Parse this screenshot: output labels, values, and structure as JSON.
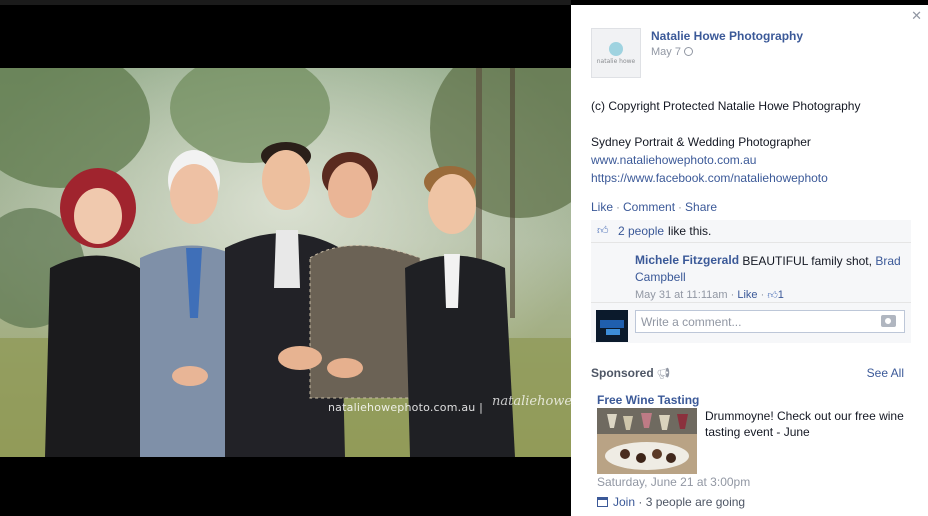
{
  "photo": {
    "watermark": "nataliehowephoto.com.au  |",
    "signature": "nataliehowe"
  },
  "post": {
    "page_name": "Natalie Howe Photography",
    "avatar_text": "natalie howe",
    "date": "May 7",
    "lines": [
      "(c) Copyright Protected Natalie Howe Photography",
      "Sydney Portrait & Wedding Photographer"
    ],
    "links": [
      "www.nataliehowephoto.com.au",
      "https://www.facebook.com/nataliehowephoto"
    ],
    "actions": {
      "like": "Like",
      "comment": "Comment",
      "share": "Share"
    }
  },
  "ufi": {
    "likes_link": "2 people",
    "likes_suffix": "like this.",
    "comments": [
      {
        "author": "Michele Fitzgerald",
        "text": "BEAUTIFUL family shot,",
        "tag": "Brad Campbell",
        "time": "May 31 at 11:11am",
        "like_label": "Like",
        "like_count": "1"
      }
    ],
    "write_placeholder": "Write a comment..."
  },
  "sponsored": {
    "label": "Sponsored",
    "see_all": "See All",
    "ad": {
      "title": "Free Wine Tasting",
      "body": "Drummoyne! Check out our free wine tasting event - June",
      "date": "Saturday, June 21 at 3:00pm",
      "join": "Join",
      "going": "· 3 people are going"
    }
  },
  "icons": {
    "close": "close-icon",
    "globe": "globe-icon",
    "thumb": "thumbs-up-icon",
    "camera": "camera-icon",
    "megaphone": "megaphone-icon",
    "calendar": "calendar-icon"
  },
  "colors": {
    "link": "#3b5998",
    "muted": "#9197a3",
    "panel": "#f6f7f9"
  }
}
